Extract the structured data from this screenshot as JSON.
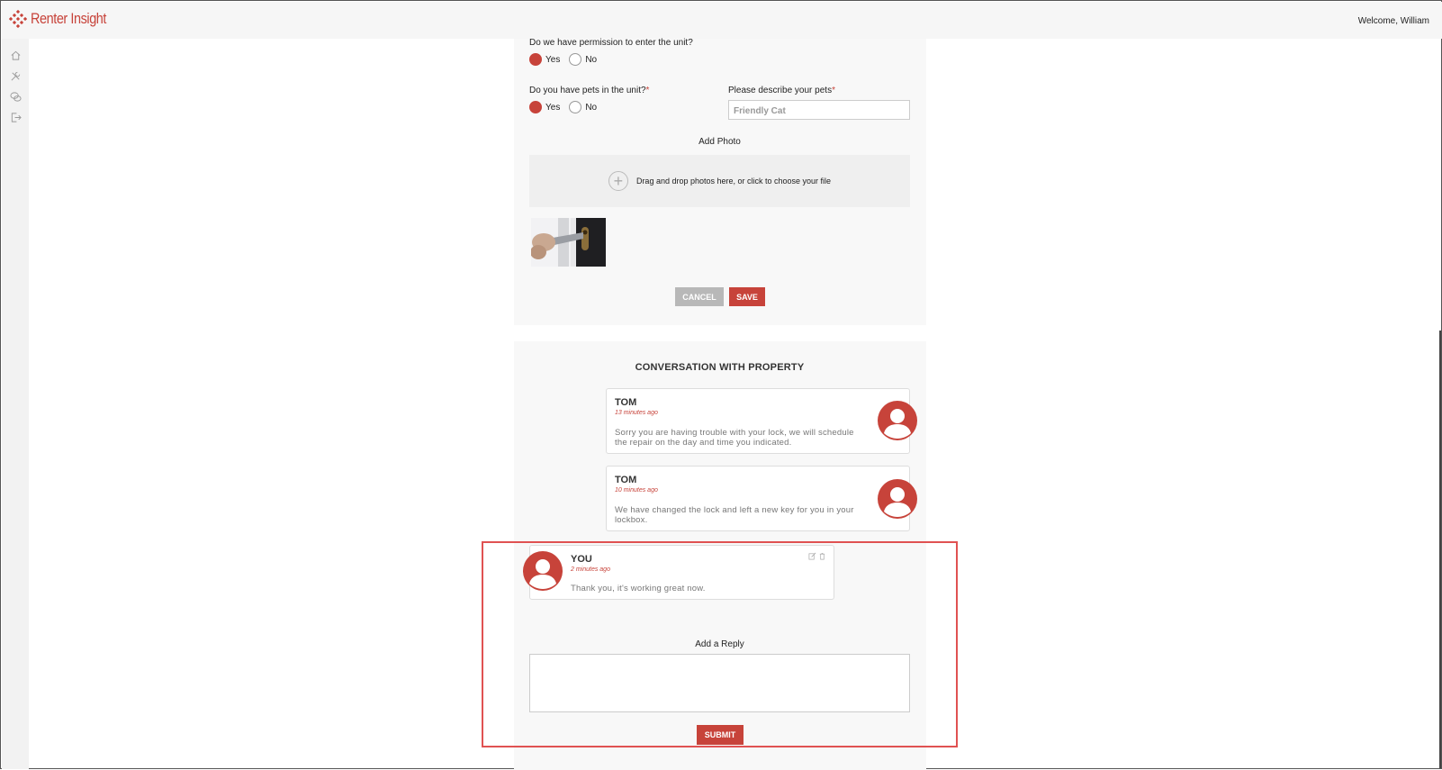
{
  "app": {
    "brand": "Renter Insight",
    "welcome": "Welcome, William",
    "accent_color": "#c7433a"
  },
  "sidebar": {
    "icons": [
      "home-icon",
      "tools-icon",
      "chat-icon",
      "logout-icon"
    ]
  },
  "form": {
    "permission_question": "Do we have permission to enter the unit?",
    "permission_yes": "Yes",
    "permission_no": "No",
    "permission_selected": "Yes",
    "pets_question": "Do you have pets in the unit?",
    "pets_required": "*",
    "pets_yes": "Yes",
    "pets_no": "No",
    "pets_selected": "Yes",
    "pets_describe_label": "Please describe your pets",
    "pets_describe_required": "*",
    "pets_describe_value": "Friendly Cat",
    "add_photo_label": "Add Photo",
    "dropzone_text": "Drag and drop photos here, or click to choose your file",
    "cancel_label": "CANCEL",
    "save_label": "SAVE"
  },
  "conversation": {
    "title": "CONVERSATION WITH PROPERTY",
    "messages": [
      {
        "author": "TOM",
        "time": "13 minutes ago",
        "body_line1": "Sorry you are having trouble with your lock, we will schedule",
        "body_line2": "the repair on the day and time you indicated."
      },
      {
        "author": "TOM",
        "time": "10 minutes ago",
        "body_line1": "We have changed the lock and left a new key for you in your",
        "body_line2": "lockbox."
      },
      {
        "author": "YOU",
        "time": "2 minutes ago",
        "body_line1": "Thank you, it's working great now."
      }
    ],
    "reply_label": "Add a Reply",
    "submit_label": "SUBMIT"
  }
}
